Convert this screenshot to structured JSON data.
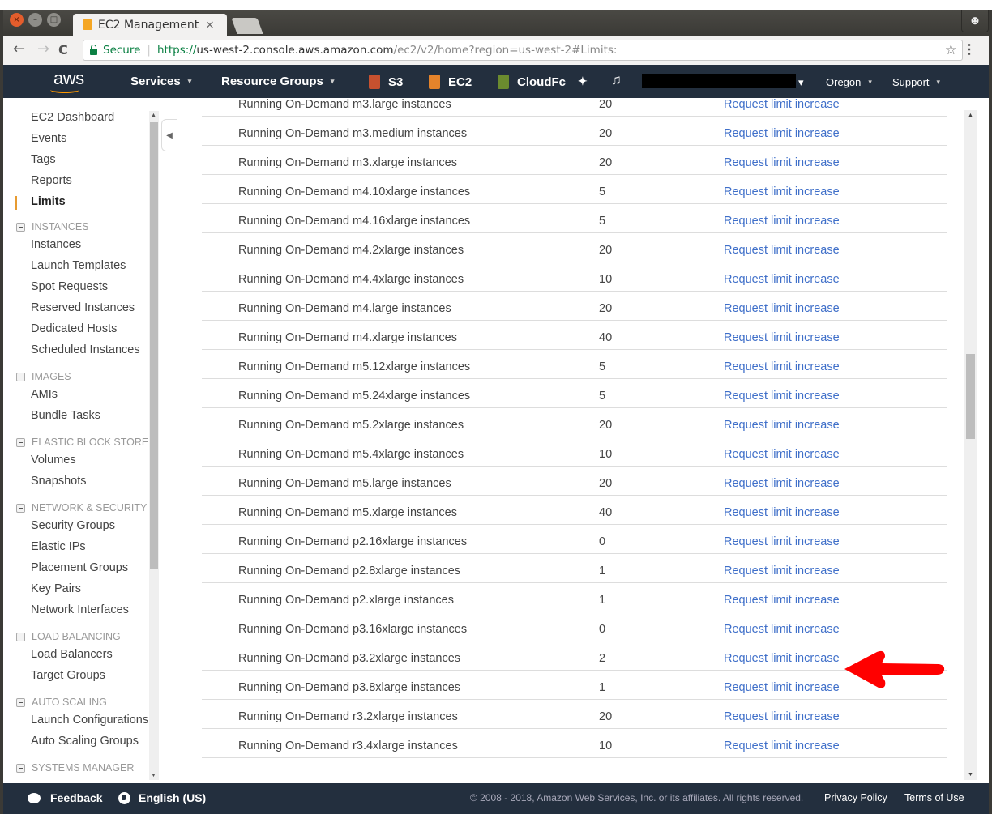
{
  "browser": {
    "tab_title": "EC2 Management C",
    "tab_close": "×",
    "secure_label": "Secure",
    "url_scheme": "https://",
    "url_host": "us-west-2.console.aws.amazon.com",
    "url_path": "/ec2/v2/home?region=us-west-2#Limits:",
    "icons": {
      "back": "←",
      "forward": "→",
      "reload": "C",
      "star": "☆",
      "menu": "⋮",
      "profile": "☻"
    }
  },
  "aws_nav": {
    "logo": "aws",
    "services": "Services",
    "resource_groups": "Resource Groups",
    "pinned": [
      {
        "label": "S3",
        "color": "#c7512f"
      },
      {
        "label": "EC2",
        "color": "#e4832b"
      },
      {
        "label": "CloudFc",
        "color": "#6b8b2f"
      }
    ],
    "pin_icon": "📌",
    "bell_icon": "🔔",
    "account_caret": "▾",
    "region": "Oregon",
    "support": "Support",
    "caret": "▾"
  },
  "sidebar": {
    "top_items": [
      {
        "label": "EC2 Dashboard"
      },
      {
        "label": "Events"
      },
      {
        "label": "Tags"
      },
      {
        "label": "Reports"
      },
      {
        "label": "Limits",
        "active": true
      }
    ],
    "sections": [
      {
        "title": "INSTANCES",
        "items": [
          "Instances",
          "Launch Templates",
          "Spot Requests",
          "Reserved Instances",
          "Dedicated Hosts",
          "Scheduled Instances"
        ]
      },
      {
        "title": "IMAGES",
        "items": [
          "AMIs",
          "Bundle Tasks"
        ]
      },
      {
        "title": "ELASTIC BLOCK STORE",
        "items": [
          "Volumes",
          "Snapshots"
        ]
      },
      {
        "title": "NETWORK & SECURITY",
        "items": [
          "Security Groups",
          "Elastic IPs",
          "Placement Groups",
          "Key Pairs",
          "Network Interfaces"
        ]
      },
      {
        "title": "LOAD BALANCING",
        "items": [
          "Load Balancers",
          "Target Groups"
        ]
      },
      {
        "title": "AUTO SCALING",
        "items": [
          "Launch Configurations",
          "Auto Scaling Groups"
        ]
      },
      {
        "title": "SYSTEMS MANAGER",
        "items": []
      }
    ],
    "accent_color": "#e79b31"
  },
  "limits_table": {
    "link_label": "Request limit increase",
    "link_color": "#3f6fc9",
    "rows": [
      {
        "name": "Running On-Demand m3.large instances",
        "limit": "20"
      },
      {
        "name": "Running On-Demand m3.medium instances",
        "limit": "20"
      },
      {
        "name": "Running On-Demand m3.xlarge instances",
        "limit": "20"
      },
      {
        "name": "Running On-Demand m4.10xlarge instances",
        "limit": "5"
      },
      {
        "name": "Running On-Demand m4.16xlarge instances",
        "limit": "5"
      },
      {
        "name": "Running On-Demand m4.2xlarge instances",
        "limit": "20"
      },
      {
        "name": "Running On-Demand m4.4xlarge instances",
        "limit": "10"
      },
      {
        "name": "Running On-Demand m4.large instances",
        "limit": "20"
      },
      {
        "name": "Running On-Demand m4.xlarge instances",
        "limit": "40"
      },
      {
        "name": "Running On-Demand m5.12xlarge instances",
        "limit": "5"
      },
      {
        "name": "Running On-Demand m5.24xlarge instances",
        "limit": "5"
      },
      {
        "name": "Running On-Demand m5.2xlarge instances",
        "limit": "20"
      },
      {
        "name": "Running On-Demand m5.4xlarge instances",
        "limit": "10"
      },
      {
        "name": "Running On-Demand m5.large instances",
        "limit": "20"
      },
      {
        "name": "Running On-Demand m5.xlarge instances",
        "limit": "40"
      },
      {
        "name": "Running On-Demand p2.16xlarge instances",
        "limit": "0"
      },
      {
        "name": "Running On-Demand p2.8xlarge instances",
        "limit": "1"
      },
      {
        "name": "Running On-Demand p2.xlarge instances",
        "limit": "1"
      },
      {
        "name": "Running On-Demand p3.16xlarge instances",
        "limit": "0"
      },
      {
        "name": "Running On-Demand p3.2xlarge instances",
        "limit": "2",
        "highlighted": true
      },
      {
        "name": "Running On-Demand p3.8xlarge instances",
        "limit": "1"
      },
      {
        "name": "Running On-Demand r3.2xlarge instances",
        "limit": "20"
      },
      {
        "name": "Running On-Demand r3.4xlarge instances",
        "limit": "10"
      }
    ]
  },
  "annotation": {
    "type": "red-arrow",
    "color": "#ff0000",
    "points_to_row": 19
  },
  "footer": {
    "feedback": "Feedback",
    "language": "English (US)",
    "copyright": "© 2008 - 2018, Amazon Web Services, Inc. or its affiliates. All rights reserved.",
    "privacy": "Privacy Policy",
    "terms": "Terms of Use"
  }
}
